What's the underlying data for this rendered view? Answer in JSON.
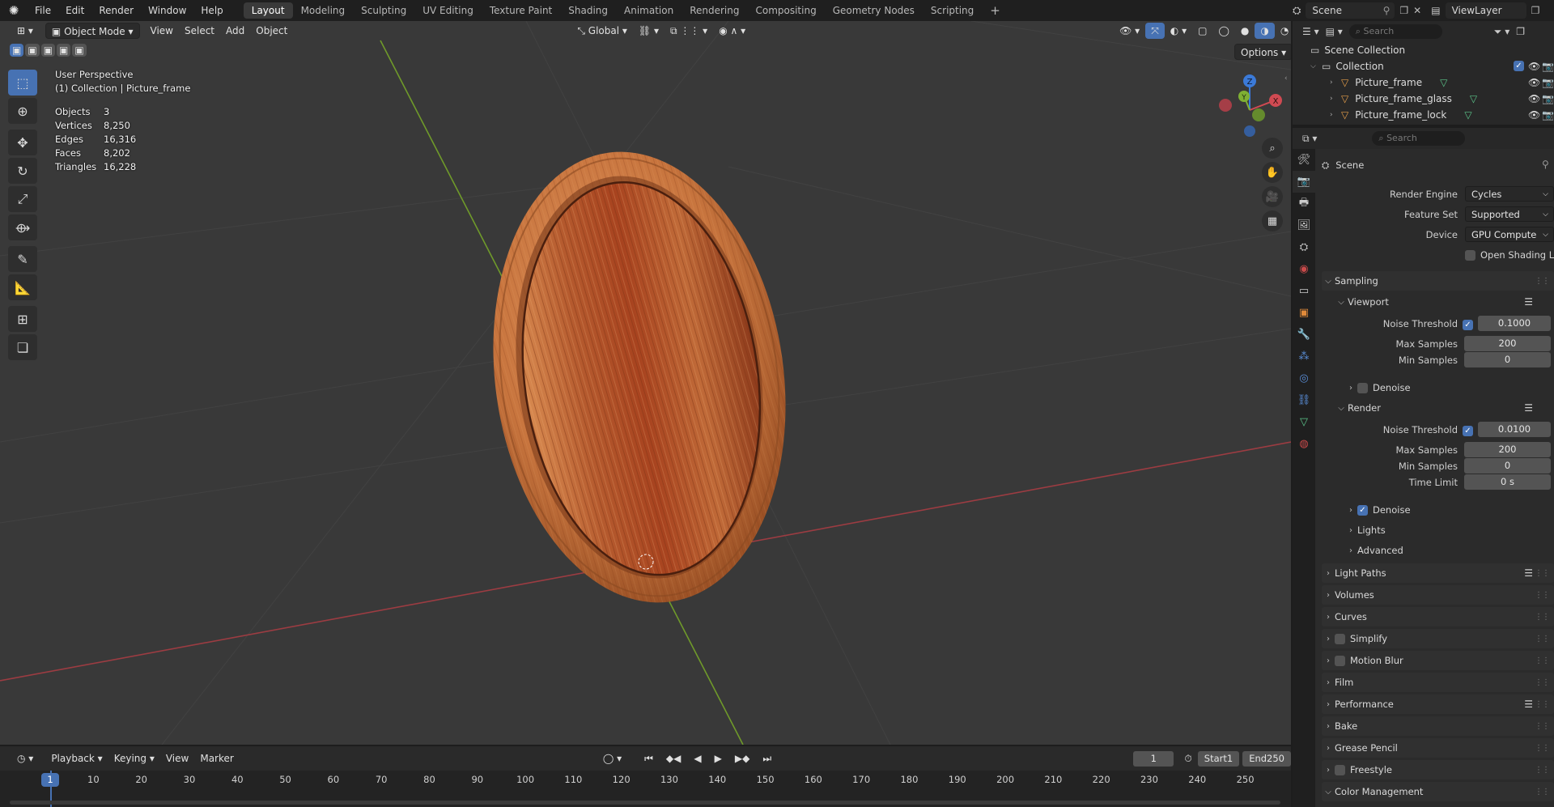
{
  "topbar": {
    "menu": [
      "File",
      "Edit",
      "Render",
      "Window",
      "Help"
    ],
    "workspaces": [
      "Layout",
      "Modeling",
      "Sculpting",
      "UV Editing",
      "Texture Paint",
      "Shading",
      "Animation",
      "Rendering",
      "Compositing",
      "Geometry Nodes",
      "Scripting"
    ],
    "active_workspace": "Layout",
    "add_tab": "+",
    "scene": "Scene",
    "view_layer": "ViewLayer"
  },
  "viewport": {
    "mode": "Object Mode",
    "menus": [
      "View",
      "Select",
      "Add",
      "Object"
    ],
    "orientation": "Global",
    "options": "Options",
    "perspective": "User Perspective",
    "collection_line": "(1) Collection | Picture_frame",
    "stats": [
      {
        "label": "Objects",
        "value": "3"
      },
      {
        "label": "Vertices",
        "value": "8,250"
      },
      {
        "label": "Edges",
        "value": "16,316"
      },
      {
        "label": "Faces",
        "value": "8,202"
      },
      {
        "label": "Triangles",
        "value": "16,228"
      }
    ],
    "gizmo": {
      "x": "X",
      "y": "Y",
      "z": "Z"
    }
  },
  "outliner": {
    "search_placeholder": "Search",
    "root": "Scene Collection",
    "collection": "Collection",
    "items": [
      "Picture_frame",
      "Picture_frame_glass",
      "Picture_frame_lock"
    ]
  },
  "properties": {
    "search_placeholder": "Search",
    "context": "Scene",
    "render_engine_label": "Render Engine",
    "render_engine": "Cycles",
    "feature_set_label": "Feature Set",
    "feature_set": "Supported",
    "device_label": "Device",
    "device": "GPU Compute",
    "osl_label": "Open Shading Language",
    "sampling": "Sampling",
    "viewport_sub": "Viewport",
    "noise_threshold_label": "Noise Threshold",
    "vp_noise": "0.1000",
    "max_samples_label": "Max Samples",
    "vp_max": "200",
    "min_samples_label": "Min Samples",
    "vp_min": "0",
    "denoise_label": "Denoise",
    "render_sub": "Render",
    "r_noise": "0.0100",
    "r_max": "200",
    "r_min": "0",
    "time_limit_label": "Time Limit",
    "r_time": "0 s",
    "lights": "Lights",
    "advanced": "Advanced",
    "panels": [
      "Light Paths",
      "Volumes",
      "Curves",
      "Simplify",
      "Motion Blur",
      "Film",
      "Performance",
      "Bake",
      "Grease Pencil",
      "Freestyle",
      "Color Management"
    ]
  },
  "timeline": {
    "menus": [
      "Playback",
      "Keying",
      "View",
      "Marker"
    ],
    "current_frame": "1",
    "start_label": "Start",
    "start": "1",
    "end_label": "End",
    "end": "250",
    "ticks": [
      "1",
      "10",
      "20",
      "30",
      "40",
      "50",
      "60",
      "70",
      "80",
      "90",
      "100",
      "110",
      "120",
      "130",
      "140",
      "150",
      "160",
      "170",
      "180",
      "190",
      "200",
      "210",
      "220",
      "230",
      "240",
      "250"
    ]
  },
  "colors": {
    "accent": "#4772b3",
    "x_axis": "#c0444c",
    "y_axis": "#76a02c",
    "wood": "#b4532a"
  }
}
